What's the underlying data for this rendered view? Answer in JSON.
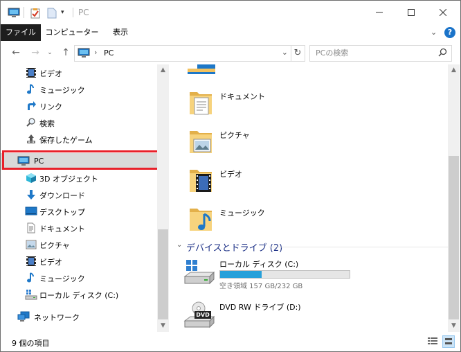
{
  "window": {
    "title": "PC"
  },
  "ribbon": {
    "tabs": [
      "ファイル",
      "コンピューター",
      "表示"
    ]
  },
  "address": {
    "crumb_sep": "›",
    "location": "PC"
  },
  "search": {
    "placeholder": "PCの検索"
  },
  "nav": {
    "items": [
      {
        "label": "ビデオ",
        "icon": "video-icon"
      },
      {
        "label": "ミュージック",
        "icon": "music-icon"
      },
      {
        "label": "リンク",
        "icon": "link-icon"
      },
      {
        "label": "検索",
        "icon": "search-icon"
      },
      {
        "label": "保存したゲーム",
        "icon": "game-icon"
      },
      {
        "label": "PC",
        "icon": "pc-icon"
      },
      {
        "label": "3D オブジェクト",
        "icon": "3d-objects-icon"
      },
      {
        "label": "ダウンロード",
        "icon": "download-icon"
      },
      {
        "label": "デスクトップ",
        "icon": "desktop-icon"
      },
      {
        "label": "ドキュメント",
        "icon": "document-icon"
      },
      {
        "label": "ピクチャ",
        "icon": "picture-icon"
      },
      {
        "label": "ビデオ",
        "icon": "video-icon"
      },
      {
        "label": "ミュージック",
        "icon": "music-icon"
      },
      {
        "label": "ローカル ディスク (C:)",
        "icon": "drive-icon"
      },
      {
        "label": "ネットワーク",
        "icon": "network-icon"
      }
    ]
  },
  "content": {
    "folders": [
      {
        "label": "ドキュメント",
        "icon": "documents-folder-icon"
      },
      {
        "label": "ピクチャ",
        "icon": "pictures-folder-icon"
      },
      {
        "label": "ビデオ",
        "icon": "videos-folder-icon"
      },
      {
        "label": "ミュージック",
        "icon": "music-folder-icon"
      }
    ],
    "group_header": "デバイスとドライブ (2)",
    "drives": [
      {
        "label": "ローカル ディスク (C:)",
        "free_text": "空き領域 157 GB/232 GB",
        "used_fraction": 0.323
      },
      {
        "label": "DVD RW ドライブ (D:)",
        "badge": "DVD"
      }
    ]
  },
  "status": {
    "item_count": "9 個の項目"
  },
  "colors": {
    "accent": "#26a0da",
    "highlight_box": "#e8202a",
    "selected_bg": "#d9d9d9"
  }
}
